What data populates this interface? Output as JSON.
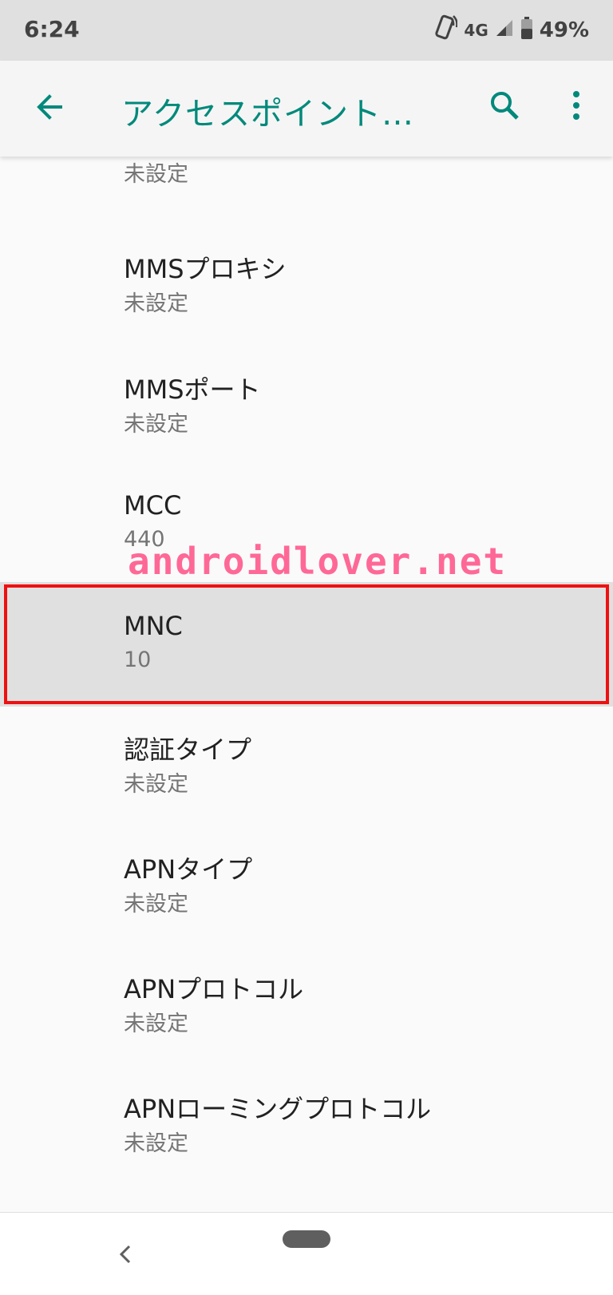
{
  "status_bar": {
    "time": "6:24",
    "network": "4G",
    "battery": "49%",
    "icons": [
      "vibrate-phone-icon",
      "signal-icon",
      "battery-icon"
    ]
  },
  "app_bar": {
    "title": "アクセスポイント…",
    "icons": [
      "back-arrow-icon",
      "search-icon",
      "more-vert-icon"
    ],
    "accent_color": "#00897b"
  },
  "settings": {
    "partial_value": "未設定",
    "items": [
      {
        "label": "MMSプロキシ",
        "value": "未設定"
      },
      {
        "label": "MMSポート",
        "value": "未設定"
      },
      {
        "label": "MCC",
        "value": "440"
      },
      {
        "label": "MNC",
        "value": "10"
      },
      {
        "label": "認証タイプ",
        "value": "未設定"
      },
      {
        "label": "APNタイプ",
        "value": "未設定"
      },
      {
        "label": "APNプロトコル",
        "value": "未設定"
      },
      {
        "label": "APNローミングプロトコル",
        "value": "未設定"
      }
    ]
  },
  "watermark": "androidlover.net",
  "nav_bar": {
    "icons": [
      "nav-back-icon",
      "home-pill-icon"
    ]
  }
}
